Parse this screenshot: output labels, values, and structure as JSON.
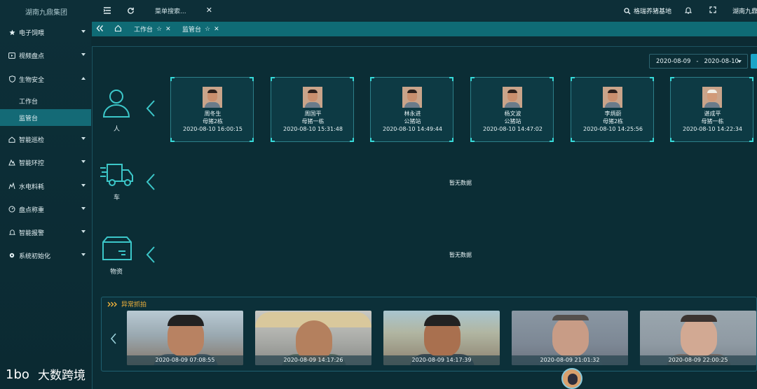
{
  "topbar": {
    "brand": "湖南九鼎集团",
    "menu_search_placeholder": "菜单搜索...",
    "farm_name": "格瑞养猪基地",
    "company": "湖南九鼎集"
  },
  "sidebar": {
    "items": [
      {
        "label": "电子饲喂",
        "icon": "star-icon"
      },
      {
        "label": "视频盘点",
        "icon": "video-icon"
      },
      {
        "label": "生物安全",
        "icon": "shield-icon"
      },
      {
        "label": "智能巡检",
        "icon": "home-icon"
      },
      {
        "label": "智能环控",
        "icon": "environment-icon"
      },
      {
        "label": "水电料耗",
        "icon": "meter-icon"
      },
      {
        "label": "盘点称重",
        "icon": "scale-icon"
      },
      {
        "label": "智能报警",
        "icon": "bell-icon"
      },
      {
        "label": "系统初始化",
        "icon": "settings-icon"
      }
    ],
    "sub_items": [
      {
        "label": "工作台",
        "active": false
      },
      {
        "label": "监管台",
        "active": true
      }
    ]
  },
  "tabs": [
    {
      "label": "工作台"
    },
    {
      "label": "监管台"
    }
  ],
  "date_range": {
    "start": "2020-08-09",
    "separator": "-",
    "end": "2020-08-10"
  },
  "rows": {
    "person": {
      "label": "人"
    },
    "vehicle": {
      "label": "车",
      "empty": "暂无数据"
    },
    "materials": {
      "label": "物资",
      "empty": "暂无数据"
    }
  },
  "person_cards": [
    {
      "name": "周冬生",
      "location": "母猪2栋",
      "time": "2020-08-10 16:00:15"
    },
    {
      "name": "周国平",
      "location": "母猪一栋",
      "time": "2020-08-10 15:31:48"
    },
    {
      "name": "林永进",
      "location": "公猪站",
      "time": "2020-08-10 14:49:44"
    },
    {
      "name": "杨文波",
      "location": "公猪站",
      "time": "2020-08-10 14:47:02"
    },
    {
      "name": "李炳蔚",
      "location": "母猪2栋",
      "time": "2020-08-10 14:25:56"
    },
    {
      "name": "谌成平",
      "location": "母猪一栋",
      "time": "2020-08-10 14:22:34"
    }
  ],
  "abnormal": {
    "title": "异常抓拍",
    "captures": [
      {
        "time": "2020-08-09 07:08:55"
      },
      {
        "time": "2020-08-09 14:17:26"
      },
      {
        "time": "2020-08-09 14:17:39"
      },
      {
        "time": "2020-08-09 21:01:32"
      },
      {
        "time": "2020-08-09 22:00:25"
      }
    ]
  },
  "watermark": {
    "text": "大数跨境",
    "logo_text": "1bo"
  },
  "colors": {
    "accent": "#0f6b75",
    "panel": "#0b2d35",
    "cyan": "#36d9d8",
    "orange": "#f1b23b"
  }
}
